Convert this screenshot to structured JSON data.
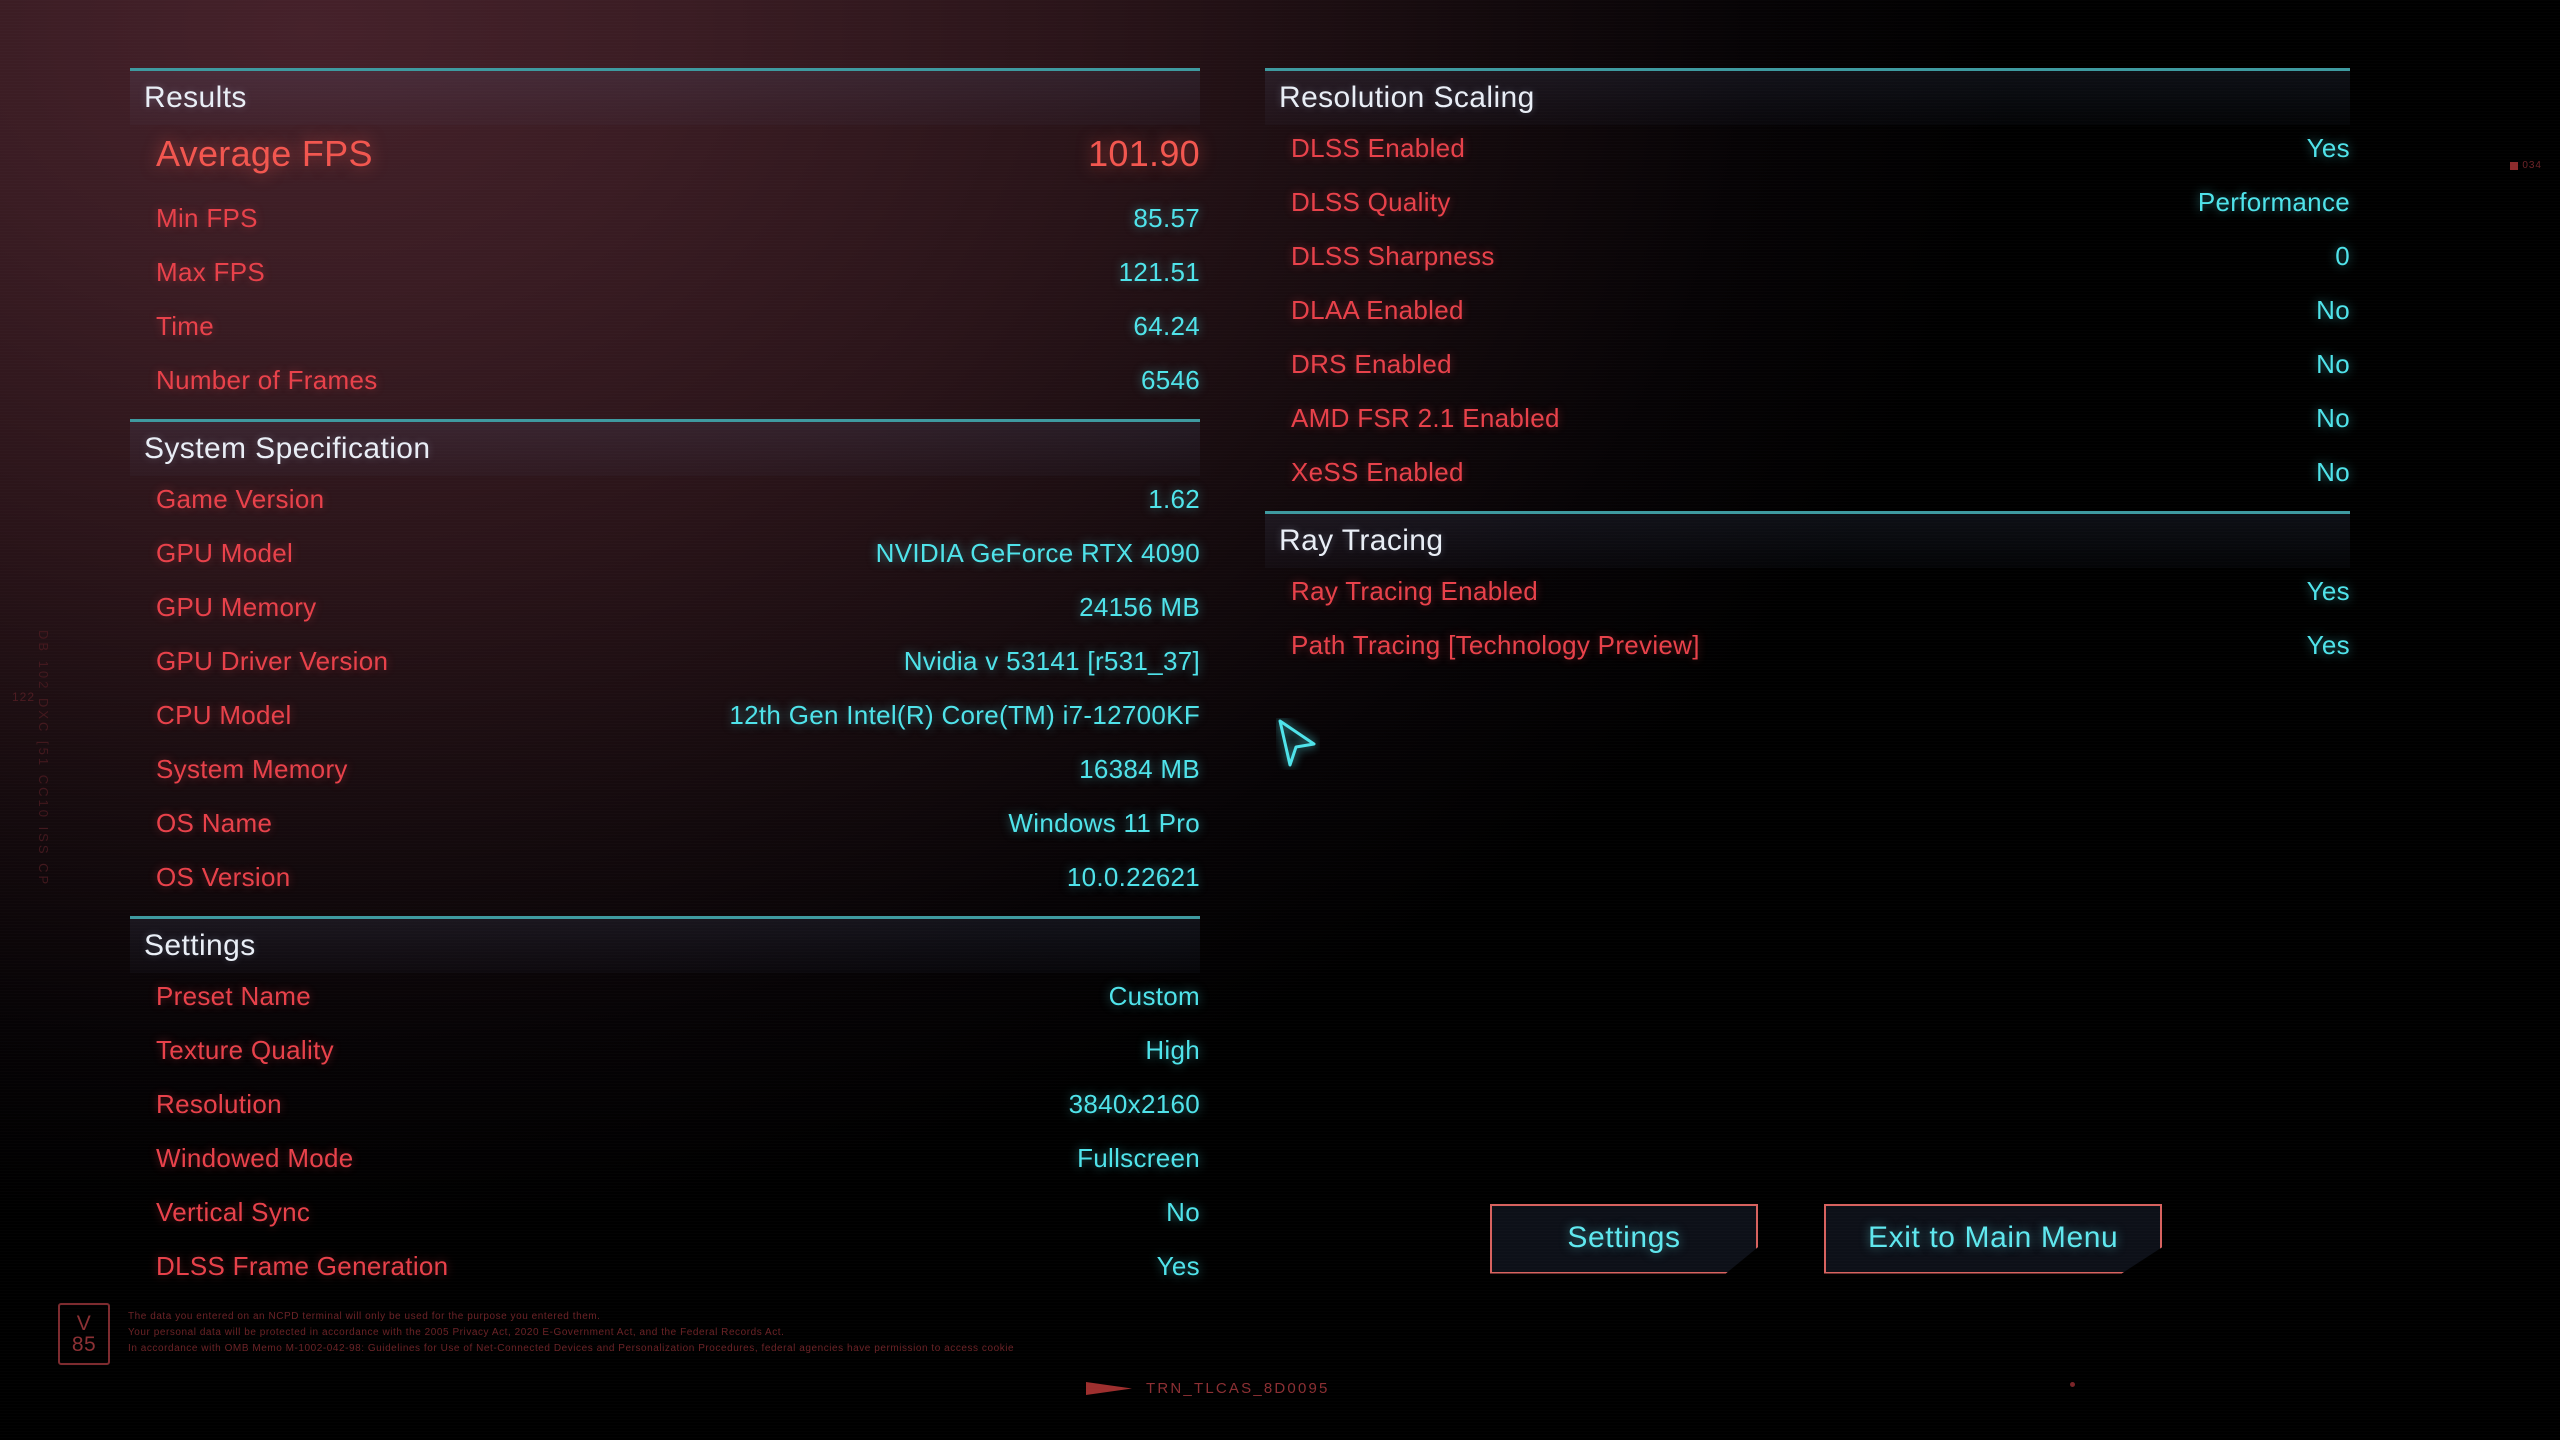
{
  "colors": {
    "label": "#e8414a",
    "value": "#4fe3ea",
    "accent_line": "#3e9aa0",
    "header_text": "#e9eef6",
    "hero": "#f2564f",
    "button_border": "#d8625f",
    "button_text": "#5fe8ef"
  },
  "left_column": {
    "sections": [
      {
        "title": "Results",
        "rows": [
          {
            "label": "Average FPS",
            "value": "101.90",
            "hero": true
          },
          {
            "label": "Min FPS",
            "value": "85.57"
          },
          {
            "label": "Max FPS",
            "value": "121.51"
          },
          {
            "label": "Time",
            "value": "64.24"
          },
          {
            "label": "Number of Frames",
            "value": "6546"
          }
        ]
      },
      {
        "title": "System Specification",
        "rows": [
          {
            "label": "Game Version",
            "value": "1.62"
          },
          {
            "label": "GPU Model",
            "value": "NVIDIA GeForce RTX 4090"
          },
          {
            "label": "GPU Memory",
            "value": "24156 MB"
          },
          {
            "label": "GPU Driver Version",
            "value": "Nvidia v 53141 [r531_37]"
          },
          {
            "label": "CPU Model",
            "value": "12th Gen Intel(R) Core(TM) i7-12700KF"
          },
          {
            "label": "System Memory",
            "value": "16384 MB"
          },
          {
            "label": "OS Name",
            "value": "Windows 11 Pro"
          },
          {
            "label": "OS Version",
            "value": "10.0.22621"
          }
        ]
      },
      {
        "title": "Settings",
        "rows": [
          {
            "label": "Preset Name",
            "value": "Custom"
          },
          {
            "label": "Texture Quality",
            "value": "High"
          },
          {
            "label": "Resolution",
            "value": "3840x2160"
          },
          {
            "label": "Windowed Mode",
            "value": "Fullscreen"
          },
          {
            "label": "Vertical Sync",
            "value": "No"
          },
          {
            "label": "DLSS Frame Generation",
            "value": "Yes"
          }
        ]
      }
    ]
  },
  "right_column": {
    "sections": [
      {
        "title": "Resolution Scaling",
        "rows": [
          {
            "label": "DLSS Enabled",
            "value": "Yes"
          },
          {
            "label": "DLSS Quality",
            "value": "Performance"
          },
          {
            "label": "DLSS Sharpness",
            "value": "0"
          },
          {
            "label": "DLAA Enabled",
            "value": "No"
          },
          {
            "label": "DRS Enabled",
            "value": "No"
          },
          {
            "label": "AMD FSR 2.1 Enabled",
            "value": "No"
          },
          {
            "label": "XeSS Enabled",
            "value": "No"
          }
        ]
      },
      {
        "title": "Ray Tracing",
        "rows": [
          {
            "label": "Ray Tracing Enabled",
            "value": "Yes"
          },
          {
            "label": "Path Tracing [Technology Preview]",
            "value": "Yes"
          }
        ]
      }
    ]
  },
  "buttons": [
    {
      "label": "Settings",
      "name": "settings-button"
    },
    {
      "label": "Exit to Main Menu",
      "name": "exit-to-main-menu-button"
    }
  ],
  "watermark": {
    "badge_line1": "V",
    "badge_line2": "85",
    "legal_lines": [
      "The data you entered on an NCPD terminal will only be used for the purpose you entered them.",
      "Your personal data will be protected in accordance with the 2005 Privacy Act, 2020 E-Government Act, and the Federal Records Act.",
      "In accordance with OMB Memo M-1002-042-98: Guidelines for Use of Net-Connected Devices and Personalization Procedures, federal agencies have permission to access cookie"
    ]
  },
  "bottom_code": "TRN_TLCAS_8D0095",
  "left_deco": "DB 102 DXC [51 CC10 ISS CP",
  "left_deco_2": "122",
  "top_right_marker": "034"
}
